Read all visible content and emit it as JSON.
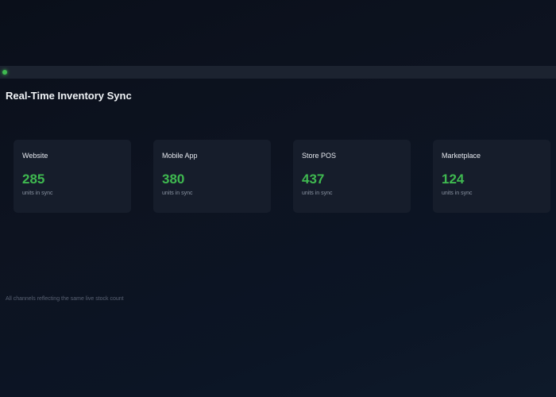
{
  "header": {
    "title": "Real-Time Inventory Sync"
  },
  "status": {
    "indicator_color": "#3fb950"
  },
  "channels": [
    {
      "name": "Website",
      "value": "285",
      "unit": "units in sync"
    },
    {
      "name": "Mobile App",
      "value": "380",
      "unit": "units in sync"
    },
    {
      "name": "Store POS",
      "value": "437",
      "unit": "units in sync"
    },
    {
      "name": "Marketplace",
      "value": "124",
      "unit": "units in sync"
    }
  ],
  "footer": {
    "note": "All channels reflecting the same live stock count"
  },
  "colors": {
    "accent": "#3fb950",
    "card_background": "#161d2b",
    "bar_background": "#1c2330"
  }
}
